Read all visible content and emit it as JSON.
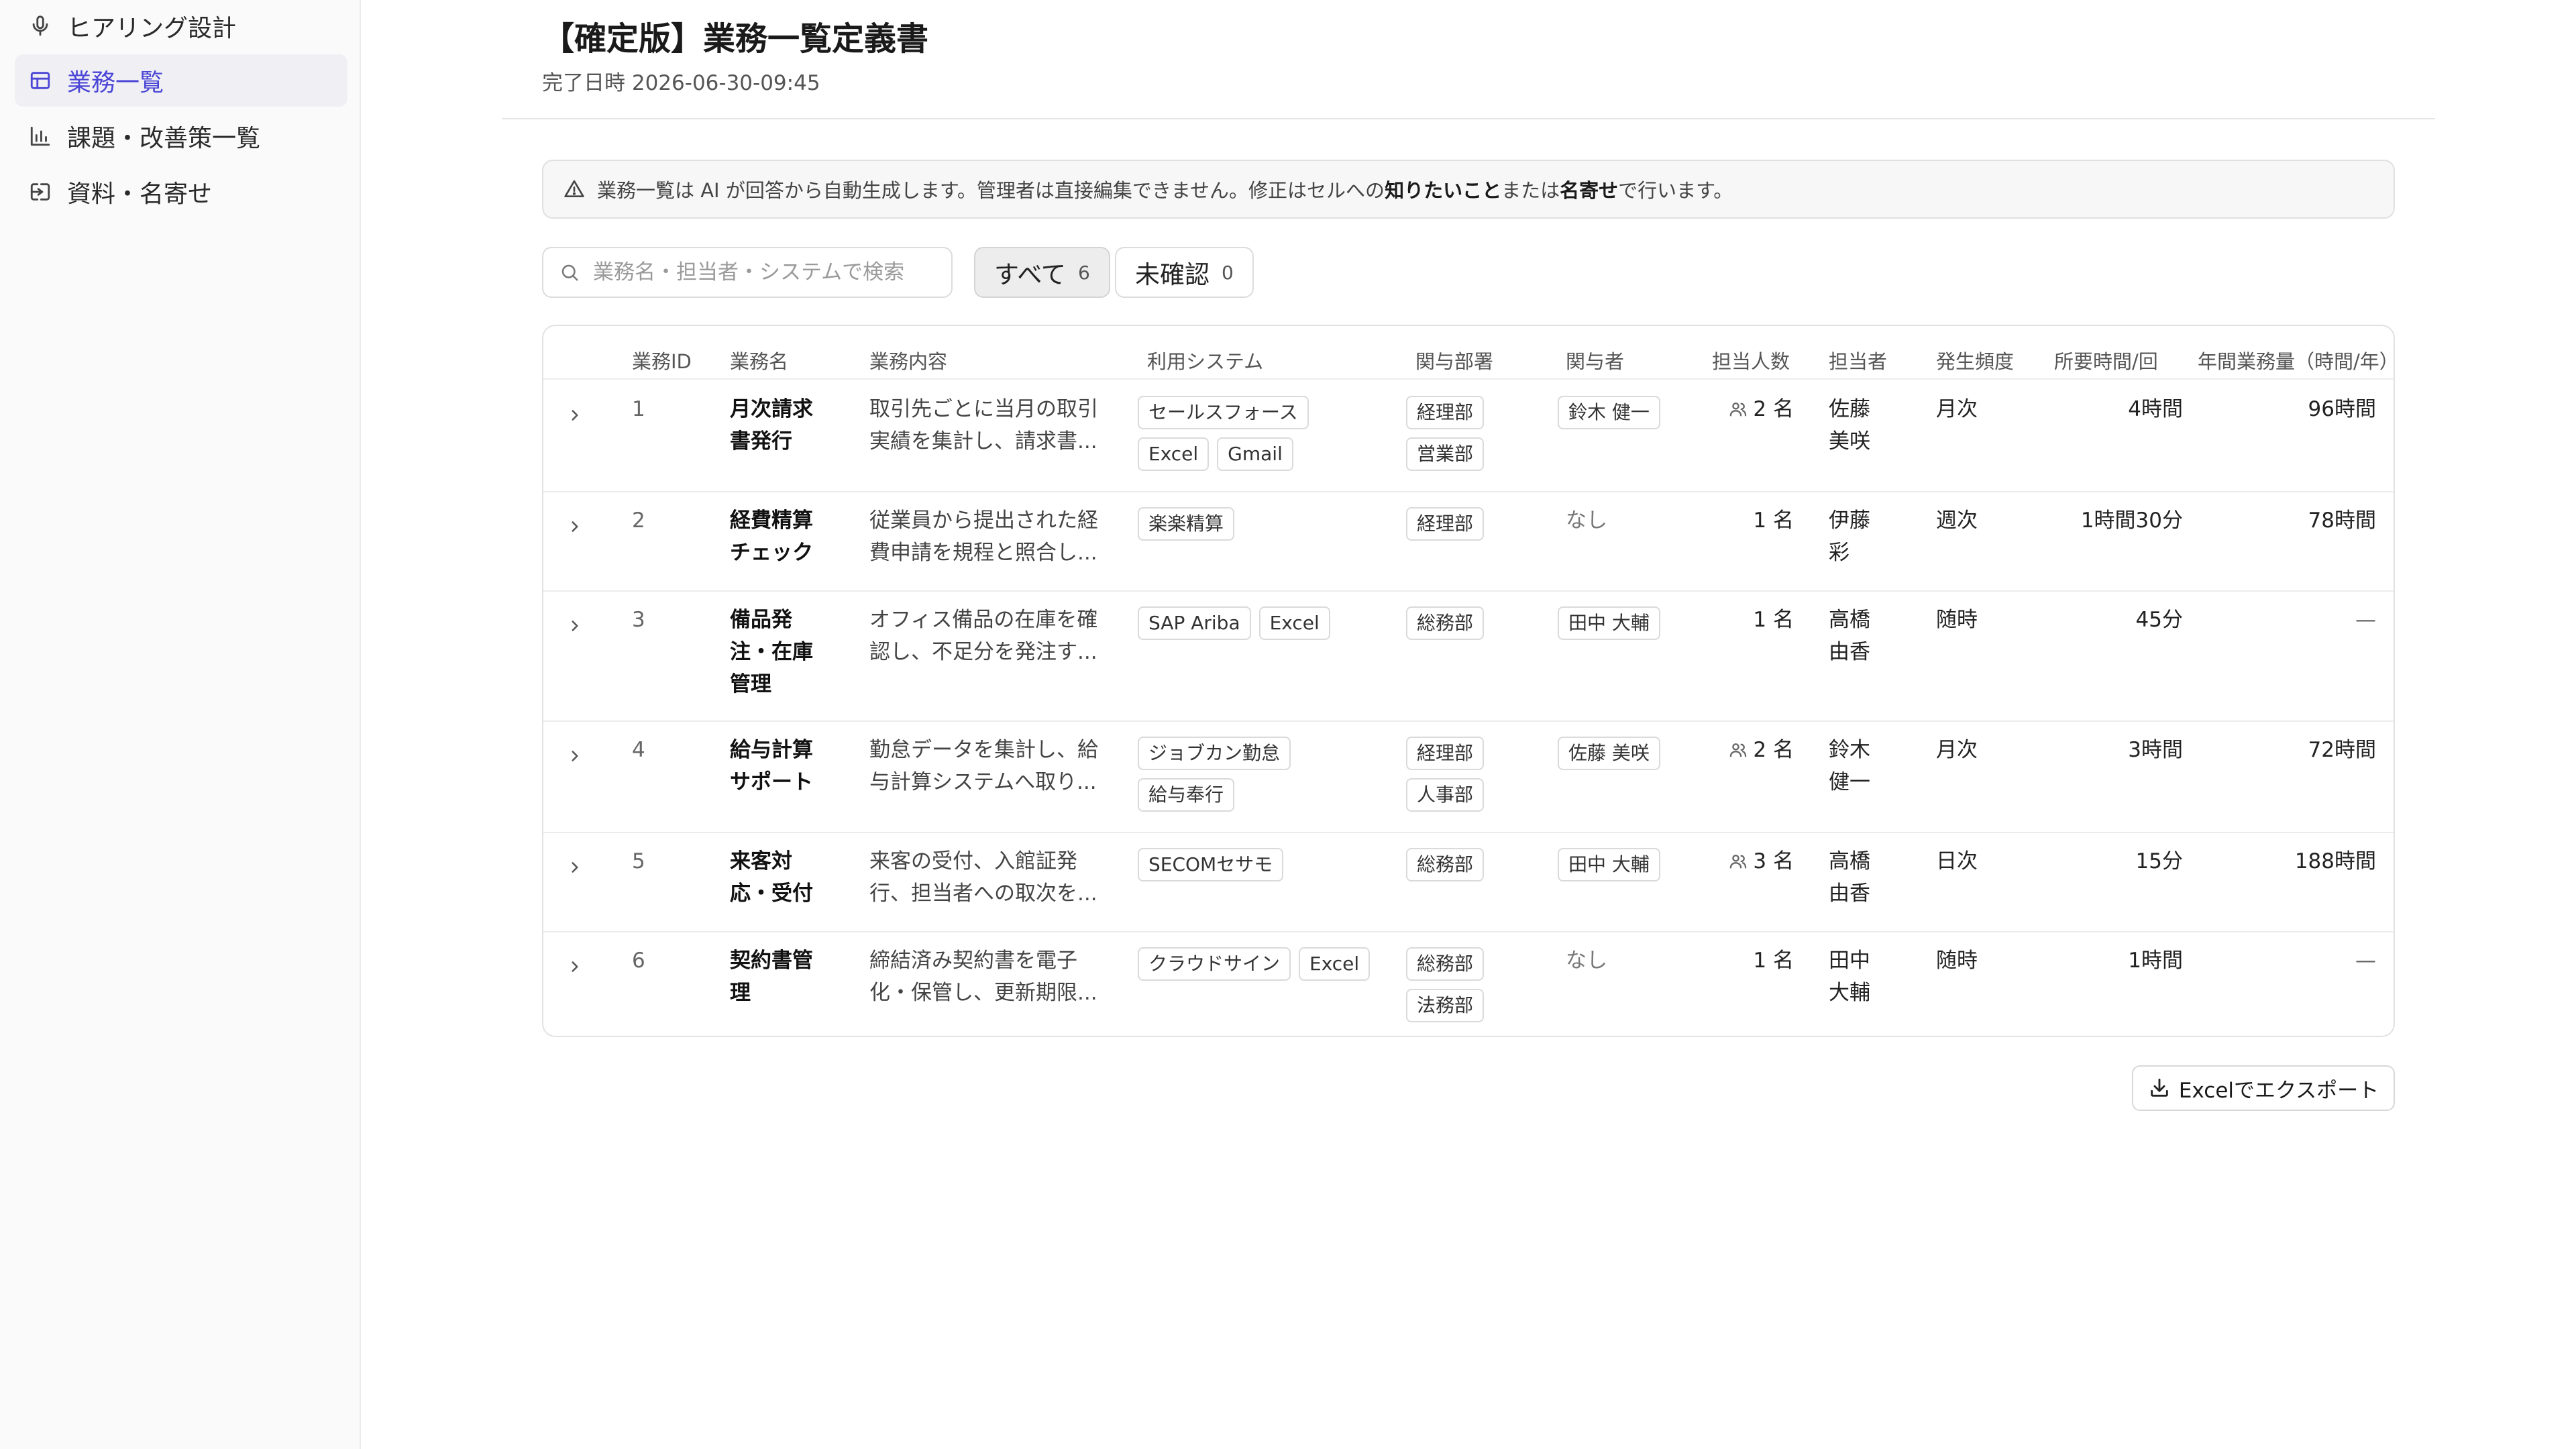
{
  "sidebar": {
    "items": [
      {
        "label": "ヒアリング設計",
        "icon": "microphone-icon"
      },
      {
        "label": "業務一覧",
        "icon": "table-icon",
        "active": true
      },
      {
        "label": "課題・改善策一覧",
        "icon": "bar-chart-icon"
      },
      {
        "label": "資料・名寄せ",
        "icon": "import-icon"
      }
    ]
  },
  "header": {
    "title": "【確定版】業務一覧定義書",
    "completed_label": "完了日時",
    "completed_at": "2026-06-30-09:45"
  },
  "notice": {
    "icon": "warning-icon",
    "text_1": "業務一覧は AI が回答から自動生成します。管理者は直接編集できません。修正はセルへの",
    "em_1": "知りたいこと",
    "text_2": "または",
    "em_2": "名寄せ",
    "text_3": "で行います。"
  },
  "search": {
    "placeholder": "業務名・担当者・システムで検索",
    "value": ""
  },
  "filters": [
    {
      "label": "すべて",
      "count": "6",
      "active": true
    },
    {
      "label": "未確認",
      "count": "0",
      "active": false
    }
  ],
  "table": {
    "columns": [
      "業務ID",
      "業務名",
      "業務内容",
      "利用システム",
      "関与部署",
      "関与者",
      "担当人数",
      "担当者",
      "発生頻度",
      "所要時間/回",
      "年間業務量（時間/年）"
    ],
    "rows": [
      {
        "id": "1",
        "name_lines": [
          "月次請求",
          "書発行"
        ],
        "desc_lines": [
          "取引先ごとに当月の取引",
          "実績を集計し、請求書..."
        ],
        "systems": [
          "セールスフォース",
          "Excel",
          "Gmail"
        ],
        "depts": [
          "経理部",
          "営業部"
        ],
        "people": [
          "鈴木 健一"
        ],
        "count": "2 名",
        "count_icon": true,
        "owner_lines": [
          "佐藤",
          "美咲"
        ],
        "freq": "月次",
        "time": "4時間",
        "annual": "96時間"
      },
      {
        "id": "2",
        "name_lines": [
          "経費精算",
          "チェック"
        ],
        "desc_lines": [
          "従業員から提出された経",
          "費申請を規程と照合し..."
        ],
        "systems": [
          "楽楽精算"
        ],
        "depts": [
          "経理部"
        ],
        "people_text": "なし",
        "count": "1 名",
        "count_icon": false,
        "owner_lines": [
          "伊藤",
          "彩"
        ],
        "freq": "週次",
        "time": "1時間30分",
        "annual": "78時間"
      },
      {
        "id": "3",
        "name_lines": [
          "備品発",
          "注・在庫",
          "管理"
        ],
        "desc_lines": [
          "オフィス備品の在庫を確",
          "認し、不足分を発注す..."
        ],
        "systems": [
          "SAP Ariba",
          "Excel"
        ],
        "depts": [
          "総務部"
        ],
        "people": [
          "田中 大輔"
        ],
        "count": "1 名",
        "count_icon": false,
        "owner_lines": [
          "高橋",
          "由香"
        ],
        "freq": "随時",
        "time": "45分",
        "annual": "—"
      },
      {
        "id": "4",
        "name_lines": [
          "給与計算",
          "サポート"
        ],
        "desc_lines": [
          "勤怠データを集計し、給",
          "与計算システムへ取り..."
        ],
        "systems": [
          "ジョブカン勤怠",
          "給与奉行"
        ],
        "depts": [
          "経理部",
          "人事部"
        ],
        "people": [
          "佐藤 美咲"
        ],
        "count": "2 名",
        "count_icon": true,
        "owner_lines": [
          "鈴木",
          "健一"
        ],
        "freq": "月次",
        "time": "3時間",
        "annual": "72時間"
      },
      {
        "id": "5",
        "name_lines": [
          "来客対",
          "応・受付"
        ],
        "desc_lines": [
          "来客の受付、入館証発",
          "行、担当者への取次を..."
        ],
        "systems": [
          "SECOMセサモ"
        ],
        "depts": [
          "総務部"
        ],
        "people": [
          "田中 大輔"
        ],
        "count": "3 名",
        "count_icon": true,
        "owner_lines": [
          "高橋",
          "由香"
        ],
        "freq": "日次",
        "time": "15分",
        "annual": "188時間"
      },
      {
        "id": "6",
        "name_lines": [
          "契約書管",
          "理"
        ],
        "desc_lines": [
          "締結済み契約書を電子",
          "化・保管し、更新期限..."
        ],
        "systems": [
          "クラウドサイン",
          "Excel"
        ],
        "depts": [
          "総務部",
          "法務部"
        ],
        "people_text": "なし",
        "count": "1 名",
        "count_icon": false,
        "owner_lines": [
          "田中",
          "大輔"
        ],
        "freq": "随時",
        "time": "1時間",
        "annual": "—"
      }
    ]
  },
  "export_button": {
    "label": "Excelでエクスポート",
    "icon": "download-icon"
  }
}
